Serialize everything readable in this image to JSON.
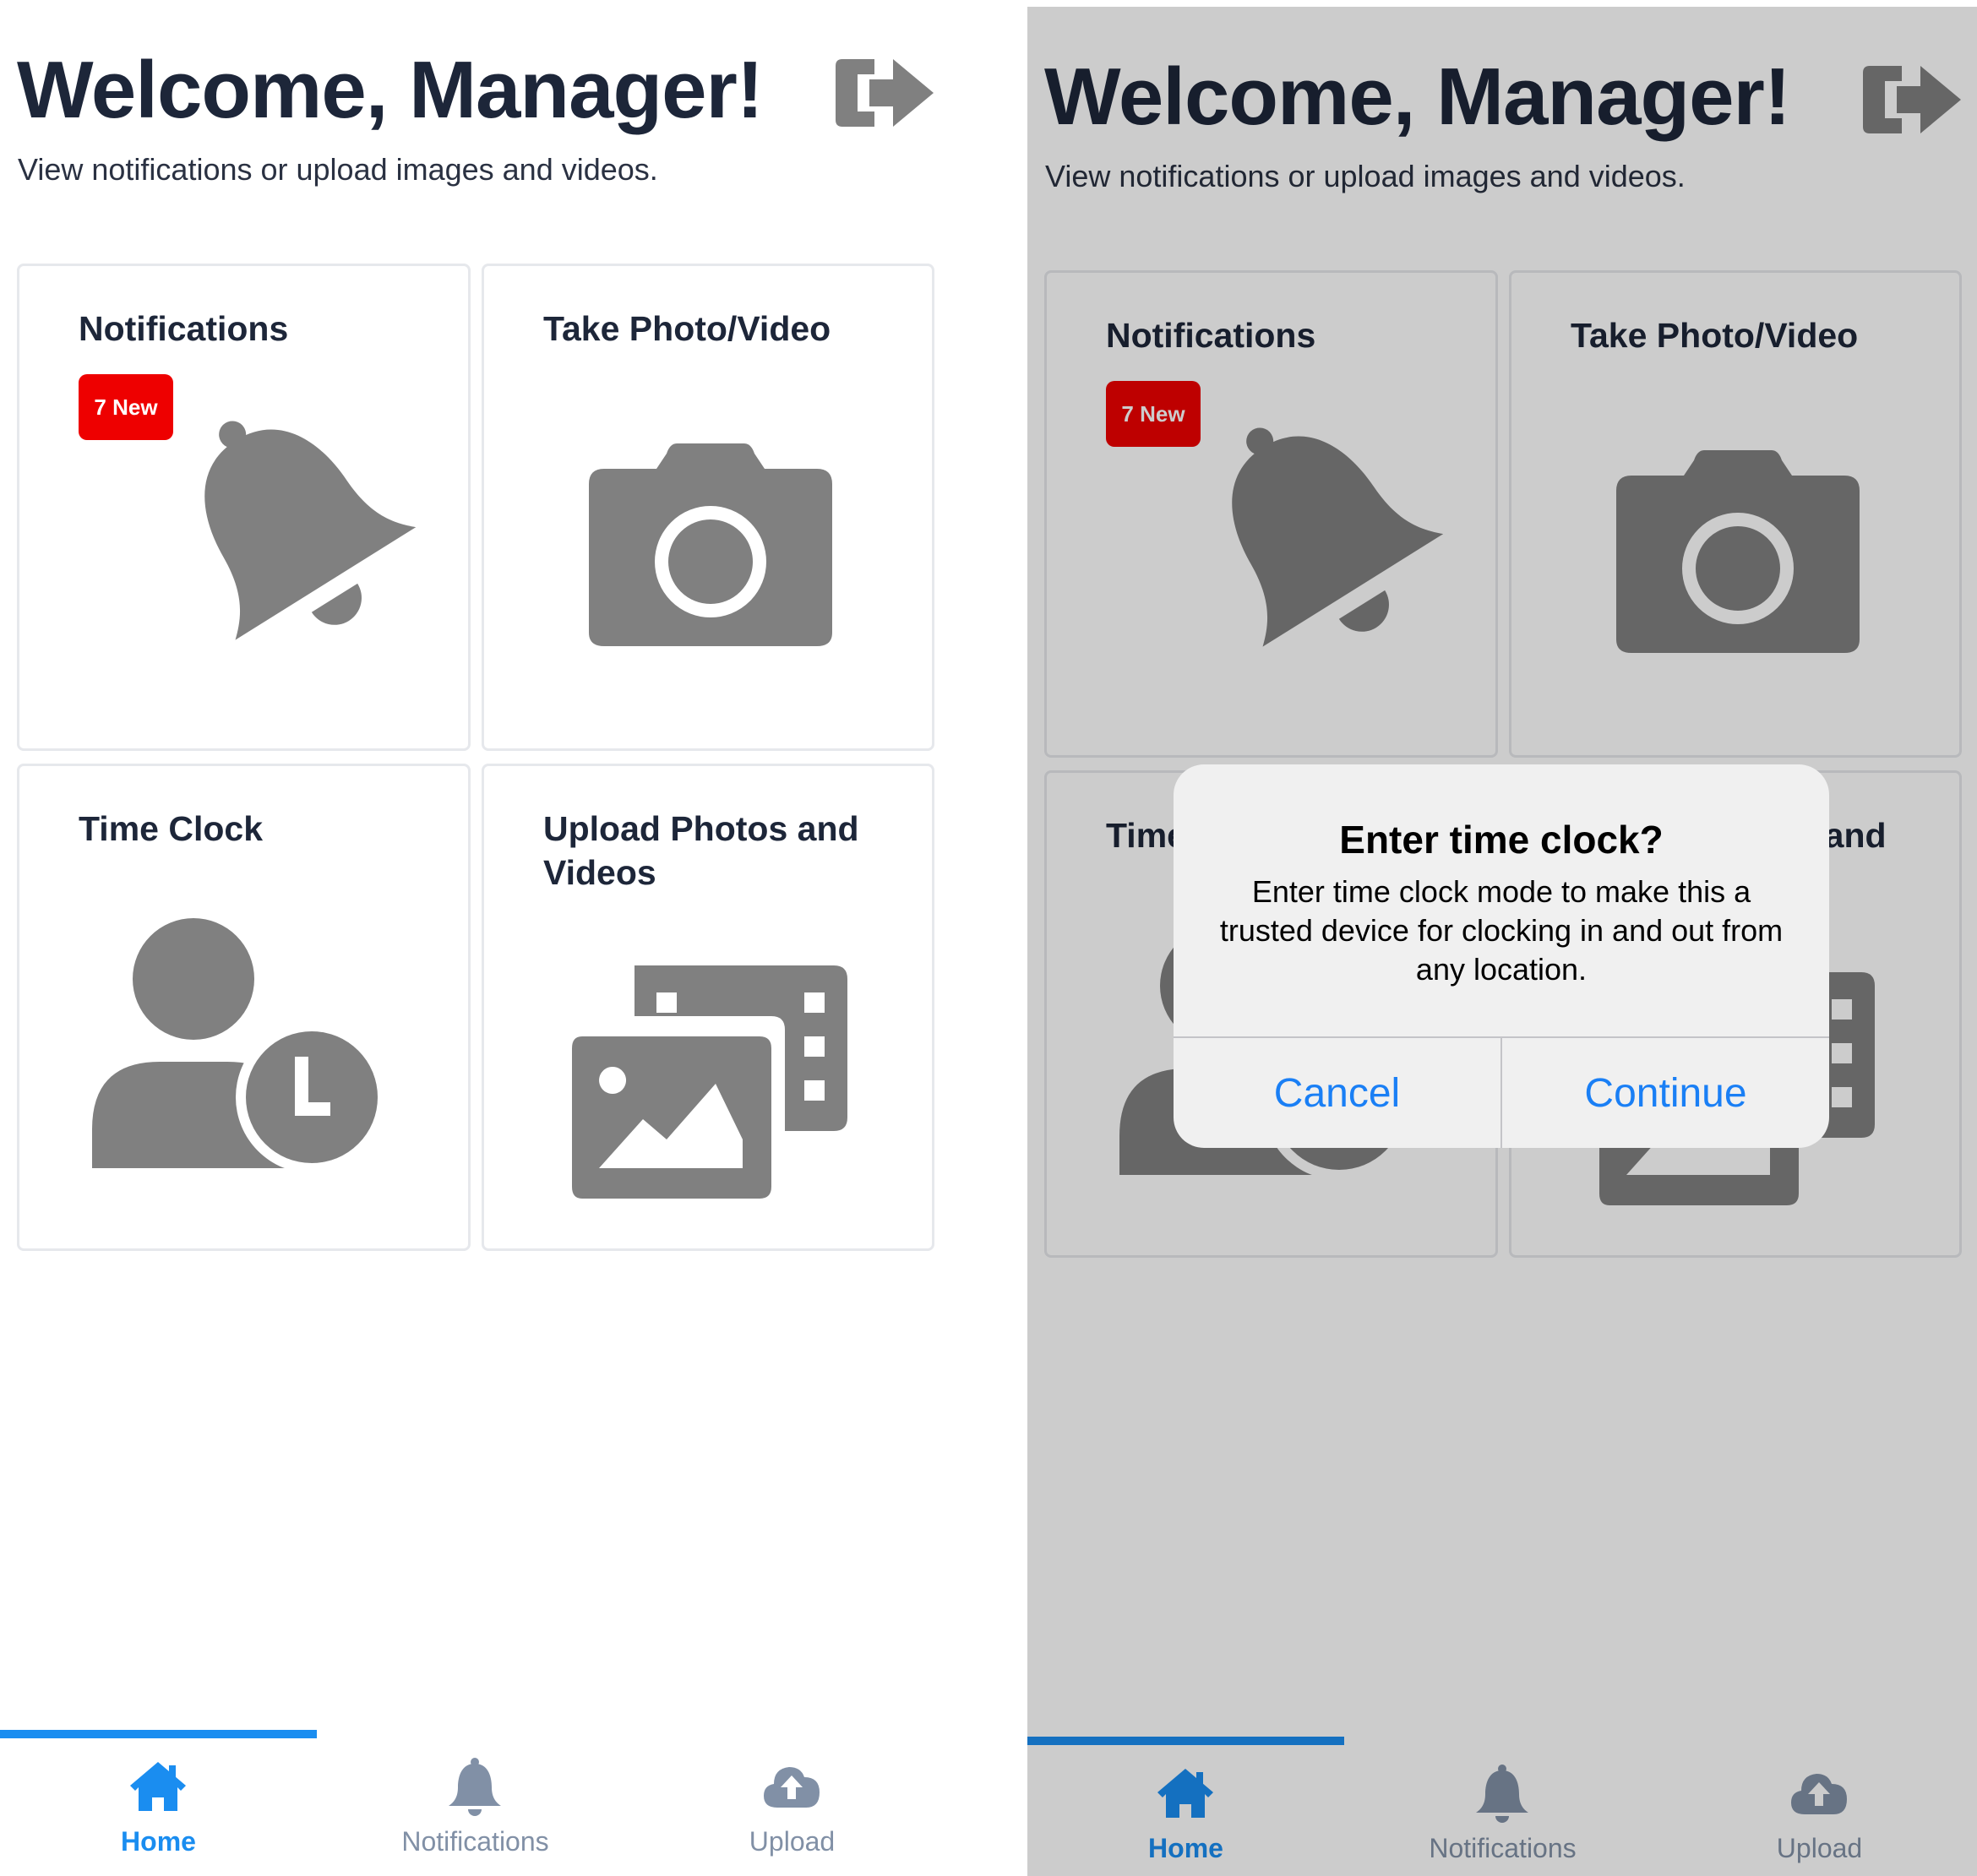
{
  "header": {
    "title": "Welcome, Manager!",
    "subtitle": "View notifications or upload images and videos."
  },
  "cards": [
    {
      "title": "Notifications",
      "badge": "7 New",
      "icon": "bell-icon"
    },
    {
      "title": "Take Photo/Video",
      "icon": "camera-icon"
    },
    {
      "title": "Time Clock",
      "icon": "user-clock-icon"
    },
    {
      "title": "Upload Photos and Videos",
      "icon": "photo-film-icon"
    }
  ],
  "tabs": [
    {
      "label": "Home",
      "icon": "home-icon",
      "active": true
    },
    {
      "label": "Notifications",
      "icon": "bell-icon",
      "active": false
    },
    {
      "label": "Upload",
      "icon": "cloud-upload-icon",
      "active": false
    }
  ],
  "dialog": {
    "title": "Enter time clock?",
    "message": "Enter time clock mode to make this a trusted device for clocking in and out from any location.",
    "cancel_label": "Cancel",
    "continue_label": "Continue"
  },
  "colors": {
    "accent": "#1a8df0",
    "title_text": "#1d2639",
    "icon_gray": "#808080",
    "badge_red": "#ee0000",
    "tab_inactive": "#8190a6",
    "dialog_button": "#1a7ff5"
  }
}
